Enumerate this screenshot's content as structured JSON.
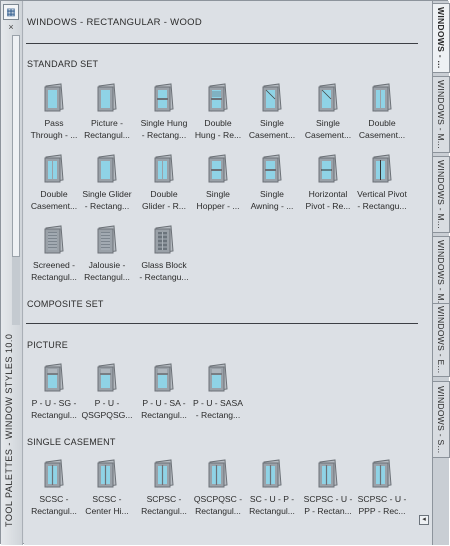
{
  "palette": {
    "title": "WINDOWS - RECTANGULAR - WOOD",
    "side_title": "TOOL PALETTES - WINDOW STYLES 10.0"
  },
  "sections": {
    "standard": "STANDARD SET",
    "composite": "COMPOSITE SET",
    "picture": "PICTURE",
    "single_casement": "SINGLE CASEMENT"
  },
  "standard_tools": [
    {
      "l1": "Pass",
      "l2": "Through - ...",
      "icon": "pass-through-window-icon"
    },
    {
      "l1": "Picture -",
      "l2": "Rectangul...",
      "icon": "picture-window-icon"
    },
    {
      "l1": "Single Hung",
      "l2": "- Rectang...",
      "icon": "single-hung-window-icon"
    },
    {
      "l1": "Double",
      "l2": "Hung - Re...",
      "icon": "double-hung-window-icon"
    },
    {
      "l1": "Single",
      "l2": "Casement...",
      "icon": "single-casement-window-icon"
    },
    {
      "l1": "Single",
      "l2": "Casement...",
      "icon": "single-casement-window-icon"
    },
    {
      "l1": "Double",
      "l2": "Casement...",
      "icon": "double-casement-window-icon"
    },
    {
      "l1": "Double",
      "l2": "Casement...",
      "icon": "double-casement-window-icon"
    },
    {
      "l1": "Single Glider",
      "l2": "- Rectang...",
      "icon": "single-glider-window-icon"
    },
    {
      "l1": "Double",
      "l2": "Glider - R...",
      "icon": "double-glider-window-icon"
    },
    {
      "l1": "Single",
      "l2": "Hopper - ...",
      "icon": "single-hopper-window-icon"
    },
    {
      "l1": "Single",
      "l2": "Awning - ...",
      "icon": "single-awning-window-icon"
    },
    {
      "l1": "Horizontal",
      "l2": "Pivot - Re...",
      "icon": "horizontal-pivot-window-icon"
    },
    {
      "l1": "Vertical Pivot",
      "l2": "- Rectangu...",
      "icon": "vertical-pivot-window-icon"
    },
    {
      "l1": "Screened -",
      "l2": "Rectangul...",
      "icon": "screened-window-icon"
    },
    {
      "l1": "Jalousie -",
      "l2": "Rectangul...",
      "icon": "jalousie-window-icon"
    },
    {
      "l1": "Glass Block",
      "l2": "- Rectangu...",
      "icon": "glass-block-window-icon"
    }
  ],
  "picture_tools": [
    {
      "l1": "P - U - SG -",
      "l2": "Rectangul...",
      "icon": "composite-picture-window-icon"
    },
    {
      "l1": "P - U -",
      "l2": "QSGPQSG...",
      "icon": "composite-picture-window-icon"
    },
    {
      "l1": "P - U - SA -",
      "l2": "Rectangul...",
      "icon": "composite-picture-window-icon"
    },
    {
      "l1": "P - U - SASA",
      "l2": "- Rectang...",
      "icon": "composite-picture-window-icon"
    }
  ],
  "casement_tools": [
    {
      "l1": "SCSC -",
      "l2": "Rectangul...",
      "icon": "composite-casement-window-icon"
    },
    {
      "l1": "SCSC -",
      "l2": "Center Hi...",
      "icon": "composite-casement-window-icon"
    },
    {
      "l1": "SCPSC -",
      "l2": "Rectangul...",
      "icon": "composite-casement-window-icon"
    },
    {
      "l1": "QSCPQSC -",
      "l2": "Rectangul...",
      "icon": "composite-casement-window-icon"
    },
    {
      "l1": "SC - U - P -",
      "l2": "Rectangul...",
      "icon": "composite-casement-window-icon"
    },
    {
      "l1": "SCPSC - U -",
      "l2": "P - Rectan...",
      "icon": "composite-casement-window-icon"
    },
    {
      "l1": "SCPSC - U -",
      "l2": "PPP - Rec...",
      "icon": "composite-casement-window-icon"
    }
  ],
  "tabs": [
    {
      "label": "WINDOWS - ...",
      "active": true
    },
    {
      "label": "WINDOWS - M...",
      "active": false
    },
    {
      "label": "WINDOWS - M...",
      "active": false
    },
    {
      "label": "WINDOWS - M...",
      "active": false
    },
    {
      "label": "WINDOWS - E...",
      "active": false
    },
    {
      "label": "WINDOWS - S...",
      "active": false
    }
  ],
  "colors": {
    "frame": "#6c7177",
    "frame_light": "#b6bcc2",
    "glass": "#8fd3e6",
    "glass_dark": "#5fb3cc"
  }
}
